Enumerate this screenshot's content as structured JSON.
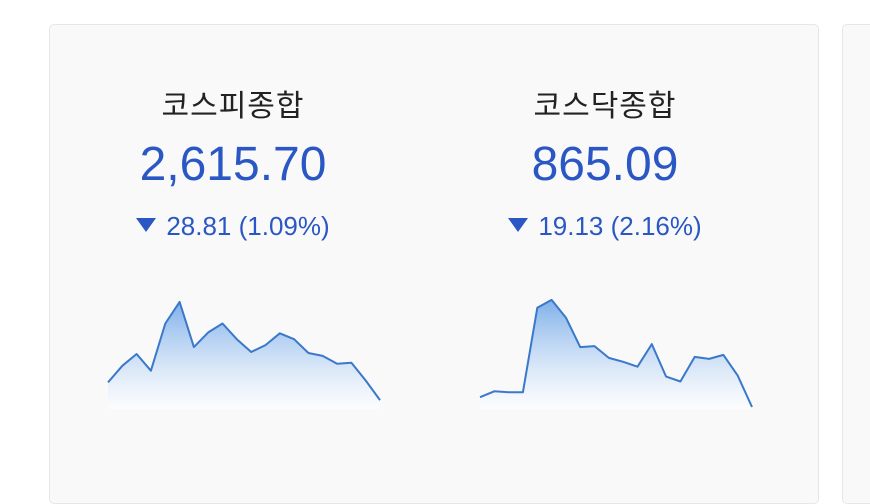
{
  "indices": [
    {
      "name": "코스피종합",
      "value": "2,615.70",
      "change_icon": "triangle-down-icon",
      "change_text": "28.81 (1.09%)",
      "direction": "down",
      "spark": [
        25,
        42,
        54,
        37,
        85,
        107,
        61,
        76,
        85,
        69,
        56,
        63,
        75,
        69,
        55,
        52,
        44,
        45,
        27,
        7
      ]
    },
    {
      "name": "코스닥종합",
      "value": "865.09",
      "change_icon": "triangle-down-icon",
      "change_text": "19.13 (2.16%)",
      "direction": "down",
      "spark": [
        10,
        16,
        15,
        15,
        101,
        109,
        91,
        61,
        62,
        50,
        46,
        41,
        64,
        31,
        26,
        51,
        49,
        53,
        32,
        0
      ]
    }
  ],
  "colors": {
    "accent": "#2b57c4",
    "line": "#3a78c9",
    "fill_top": "#7fb0ea",
    "fill_bottom": "#ffffff"
  }
}
